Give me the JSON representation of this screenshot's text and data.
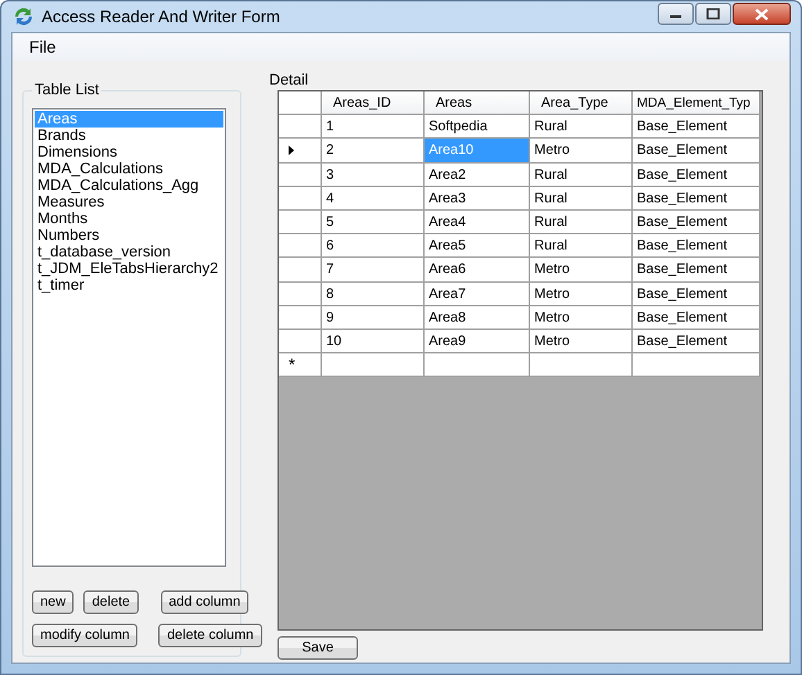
{
  "window": {
    "title": "Access Reader And Writer Form"
  },
  "menu": [
    "File"
  ],
  "table_list": {
    "label": "Table List",
    "items": [
      {
        "label": "Areas",
        "selected": true
      },
      {
        "label": "Brands",
        "selected": false
      },
      {
        "label": "Dimensions",
        "selected": false
      },
      {
        "label": "MDA_Calculations",
        "selected": false
      },
      {
        "label": "MDA_Calculations_Agg",
        "selected": false
      },
      {
        "label": "Measures",
        "selected": false
      },
      {
        "label": "Months",
        "selected": false
      },
      {
        "label": "Numbers",
        "selected": false
      },
      {
        "label": "t_database_version",
        "selected": false
      },
      {
        "label": "t_JDM_EleTabsHierarchy2",
        "selected": false
      },
      {
        "label": "t_timer",
        "selected": false
      }
    ],
    "buttons": [
      [
        "new",
        "delete",
        "add column"
      ],
      [
        "modify column",
        "delete column"
      ]
    ]
  },
  "detail": {
    "label": "Detail",
    "columns": [
      "Areas_ID",
      "Areas",
      "Area_Type",
      "MDA_Element_Typ"
    ],
    "rows": [
      {
        "current": false,
        "cells": [
          {
            "text": "1",
            "selected": false
          },
          {
            "text": "Softpedia",
            "selected": false
          },
          {
            "text": "Rural",
            "selected": false
          },
          {
            "text": "Base_Element",
            "selected": false
          }
        ]
      },
      {
        "current": true,
        "cells": [
          {
            "text": "2",
            "selected": false
          },
          {
            "text": "Area10",
            "selected": true
          },
          {
            "text": "Metro",
            "selected": false
          },
          {
            "text": "Base_Element",
            "selected": false
          }
        ]
      },
      {
        "current": false,
        "cells": [
          {
            "text": "3",
            "selected": false
          },
          {
            "text": "Area2",
            "selected": false
          },
          {
            "text": "Rural",
            "selected": false
          },
          {
            "text": "Base_Element",
            "selected": false
          }
        ]
      },
      {
        "current": false,
        "cells": [
          {
            "text": "4",
            "selected": false
          },
          {
            "text": "Area3",
            "selected": false
          },
          {
            "text": "Rural",
            "selected": false
          },
          {
            "text": "Base_Element",
            "selected": false
          }
        ]
      },
      {
        "current": false,
        "cells": [
          {
            "text": "5",
            "selected": false
          },
          {
            "text": "Area4",
            "selected": false
          },
          {
            "text": "Rural",
            "selected": false
          },
          {
            "text": "Base_Element",
            "selected": false
          }
        ]
      },
      {
        "current": false,
        "cells": [
          {
            "text": "6",
            "selected": false
          },
          {
            "text": "Area5",
            "selected": false
          },
          {
            "text": "Rural",
            "selected": false
          },
          {
            "text": "Base_Element",
            "selected": false
          }
        ]
      },
      {
        "current": false,
        "cells": [
          {
            "text": "7",
            "selected": false
          },
          {
            "text": "Area6",
            "selected": false
          },
          {
            "text": "Metro",
            "selected": false
          },
          {
            "text": "Base_Element",
            "selected": false
          }
        ]
      },
      {
        "current": false,
        "cells": [
          {
            "text": "8",
            "selected": false
          },
          {
            "text": "Area7",
            "selected": false
          },
          {
            "text": "Metro",
            "selected": false
          },
          {
            "text": "Base_Element",
            "selected": false
          }
        ]
      },
      {
        "current": false,
        "cells": [
          {
            "text": "9",
            "selected": false
          },
          {
            "text": "Area8",
            "selected": false
          },
          {
            "text": "Metro",
            "selected": false
          },
          {
            "text": "Base_Element",
            "selected": false
          }
        ]
      },
      {
        "current": false,
        "cells": [
          {
            "text": "10",
            "selected": false
          },
          {
            "text": "Area9",
            "selected": false
          },
          {
            "text": "Metro",
            "selected": false
          },
          {
            "text": "Base_Element",
            "selected": false
          }
        ]
      }
    ],
    "new_row_mark": "*"
  },
  "save_button": "Save"
}
